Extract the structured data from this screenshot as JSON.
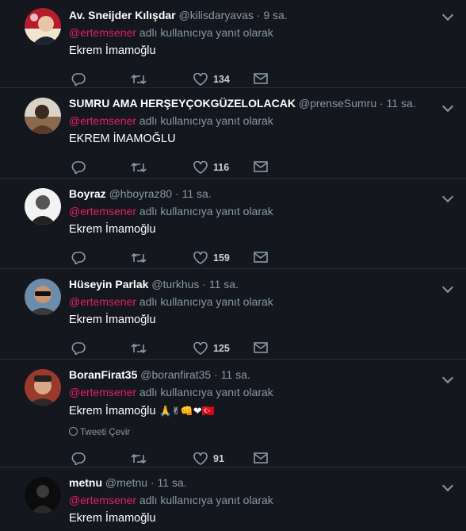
{
  "tweets": [
    {
      "name": "Av. Sneijder Kılışdar",
      "handle": "@kilisdaryavas",
      "time": "9 sa.",
      "mention": "@ertemsener",
      "reply_suffix": "adlı kullanıcıya yanıt olarak",
      "text": "Ekrem İmamoğlu",
      "likes": "134",
      "avatar_color": "#b71c2c"
    },
    {
      "name": "SUMRU AMA HERŞEYÇOKGÜZELOLACAK",
      "handle": "@prenseSumru",
      "time": "11 sa.",
      "mention": "@ertemsener",
      "reply_suffix": "adlı kullanıcıya yanıt olarak",
      "text": "EKREM İMAMOĞLU",
      "likes": "116",
      "avatar_color": "#6b4a3a"
    },
    {
      "name": "Boyraz",
      "handle": "@hboyraz80",
      "time": "11 sa.",
      "mention": "@ertemsener",
      "reply_suffix": "adlı kullanıcıya yanıt olarak",
      "text": "Ekrem İmamoğlu",
      "likes": "159",
      "avatar_color": "#e6e6e6"
    },
    {
      "name": "Hüseyin Parlak",
      "handle": "@turkhus",
      "time": "11 sa.",
      "mention": "@ertemsener",
      "reply_suffix": "adlı kullanıcıya yanıt olarak",
      "text": "Ekrem İmamoğlu",
      "likes": "125",
      "avatar_color": "#4a6b8a"
    },
    {
      "name": "BoranFirat35",
      "handle": "@boranfirat35",
      "time": "11 sa.",
      "mention": "@ertemsener",
      "reply_suffix": "adlı kullanıcıya yanıt olarak",
      "text": "Ekrem İmamoğlu",
      "emojis": "🙏✌👊❤🇹🇷",
      "translate_label": "Tweeti Çevir",
      "likes": "91",
      "avatar_color": "#7a2a2a"
    },
    {
      "name": "metnu",
      "handle": "@metnu",
      "time": "11 sa.",
      "mention": "@ertemsener",
      "reply_suffix": "adlı kullanıcıya yanıt olarak",
      "text": "Ekrem İmamoğlu",
      "avatar_color": "#0c0c0c"
    }
  ],
  "dot": "·",
  "icons": [
    "reply-icon",
    "retweet-icon",
    "like-icon",
    "direct-message-icon",
    "chevron-down-icon"
  ]
}
